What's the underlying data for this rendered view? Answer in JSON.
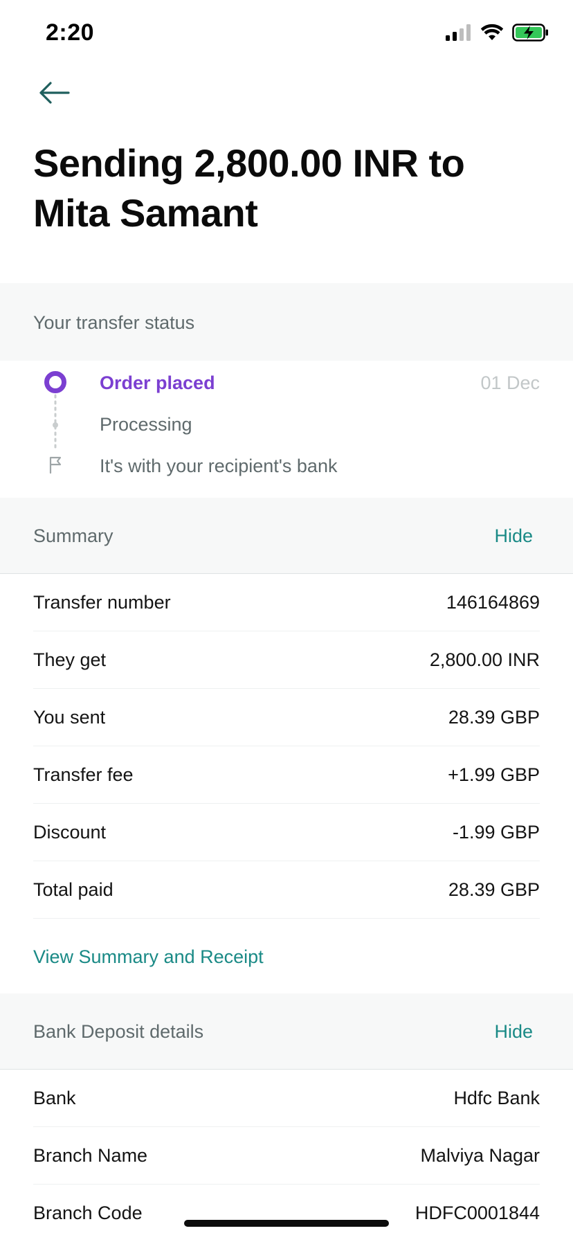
{
  "status_bar": {
    "time": "2:20"
  },
  "header": {
    "title": "Sending 2,800.00 INR to Mita Samant"
  },
  "transfer_status": {
    "label": "Your transfer status",
    "steps": [
      {
        "label": "Order placed",
        "date": "01 Dec",
        "state": "active"
      },
      {
        "label": "Processing",
        "state": "pending"
      },
      {
        "label": "It's with your recipient's bank",
        "state": "pending"
      }
    ]
  },
  "summary": {
    "label": "Summary",
    "hide_label": "Hide",
    "rows": [
      {
        "label": "Transfer number",
        "value": "146164869"
      },
      {
        "label": "They get",
        "value": "2,800.00 INR"
      },
      {
        "label": "You sent",
        "value": "28.39 GBP"
      },
      {
        "label": "Transfer fee",
        "value": "+1.99 GBP"
      },
      {
        "label": "Discount",
        "value": "-1.99 GBP"
      },
      {
        "label": "Total paid",
        "value": "28.39 GBP"
      }
    ],
    "receipt_link": "View Summary and Receipt"
  },
  "bank_deposit": {
    "label": "Bank Deposit details",
    "hide_label": "Hide",
    "rows": [
      {
        "label": "Bank",
        "value": "Hdfc Bank"
      },
      {
        "label": "Branch Name",
        "value": "Malviya Nagar"
      },
      {
        "label": "Branch Code",
        "value": "HDFC0001844"
      }
    ]
  },
  "colors": {
    "accent_purple": "#7b3fd1",
    "accent_teal": "#1a8a86",
    "section_bg": "#f7f8f8",
    "battery_green": "#34c759"
  }
}
